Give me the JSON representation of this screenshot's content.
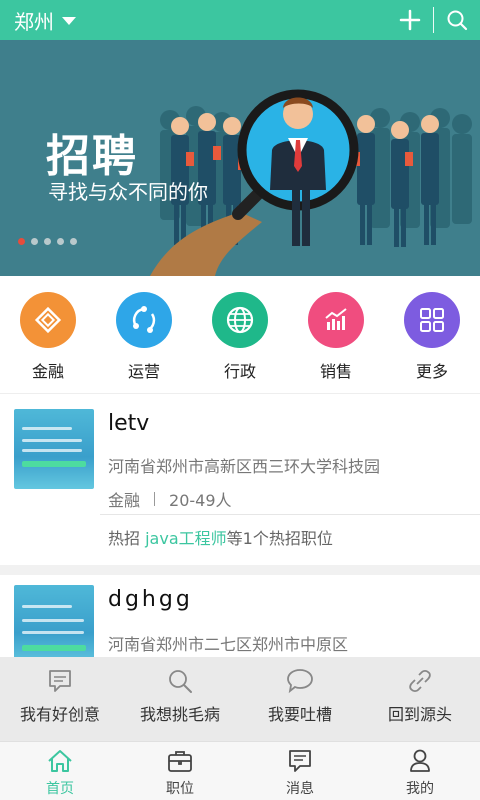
{
  "header": {
    "city": "郑州"
  },
  "banner": {
    "title": "招聘",
    "subtitle": "寻找与众不同的你",
    "active_dot": 0,
    "dot_count": 5
  },
  "categories": [
    {
      "label": "金融",
      "icon": "finance-icon",
      "color": "#f39237"
    },
    {
      "label": "运营",
      "icon": "operations-icon",
      "color": "#2ea6e8"
    },
    {
      "label": "行政",
      "icon": "globe-icon",
      "color": "#1fb88a"
    },
    {
      "label": "销售",
      "icon": "sales-chart-icon",
      "color": "#f04d7f"
    },
    {
      "label": "更多",
      "icon": "grid-icon",
      "color": "#7d5ce0"
    }
  ],
  "jobs": [
    {
      "company": "letv",
      "address": "河南省郑州市高新区西三环大学科技园",
      "industry": "金融",
      "size": "20-49人",
      "hot_prefix": "热招",
      "hot_keyword": "java工程师",
      "hot_suffix": "等1个热招职位"
    },
    {
      "company": "dghgg",
      "address": "河南省郑州市二七区郑州市中原区"
    }
  ],
  "feedback": [
    {
      "label": "我有好创意",
      "icon": "note-icon"
    },
    {
      "label": "我想挑毛病",
      "icon": "search-icon"
    },
    {
      "label": "我要吐槽",
      "icon": "chat-bubble-icon"
    },
    {
      "label": "回到源头",
      "icon": "link-icon"
    }
  ],
  "nav": [
    {
      "label": "首页",
      "icon": "home-icon",
      "active": true
    },
    {
      "label": "职位",
      "icon": "briefcase-icon",
      "active": false
    },
    {
      "label": "消息",
      "icon": "message-icon",
      "active": false
    },
    {
      "label": "我的",
      "icon": "user-icon",
      "active": false
    }
  ],
  "colors": {
    "brand": "#3cc6a0",
    "banner_bg": "#3f7f8c"
  }
}
